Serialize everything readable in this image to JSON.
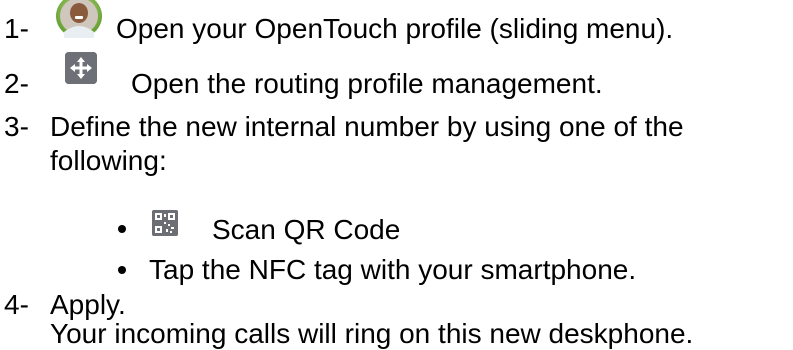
{
  "steps": [
    {
      "number": "1-",
      "text": "Open your OpenTouch profile (sliding menu).",
      "icon": "profile-photo-icon"
    },
    {
      "number": "2-",
      "text": "Open the routing profile management.",
      "icon": "routing-icon"
    },
    {
      "number": "3-",
      "text_line1": "Define the new internal number by using one of the",
      "text_line2": "following:"
    },
    {
      "number": "4-",
      "text_line1": "Apply.",
      "text_line2": "Your incoming calls will ring on this new deskphone."
    }
  ],
  "options": [
    {
      "text": "Scan QR Code",
      "icon": "qr-code-icon"
    },
    {
      "text": "Tap the NFC tag with your smartphone."
    }
  ]
}
